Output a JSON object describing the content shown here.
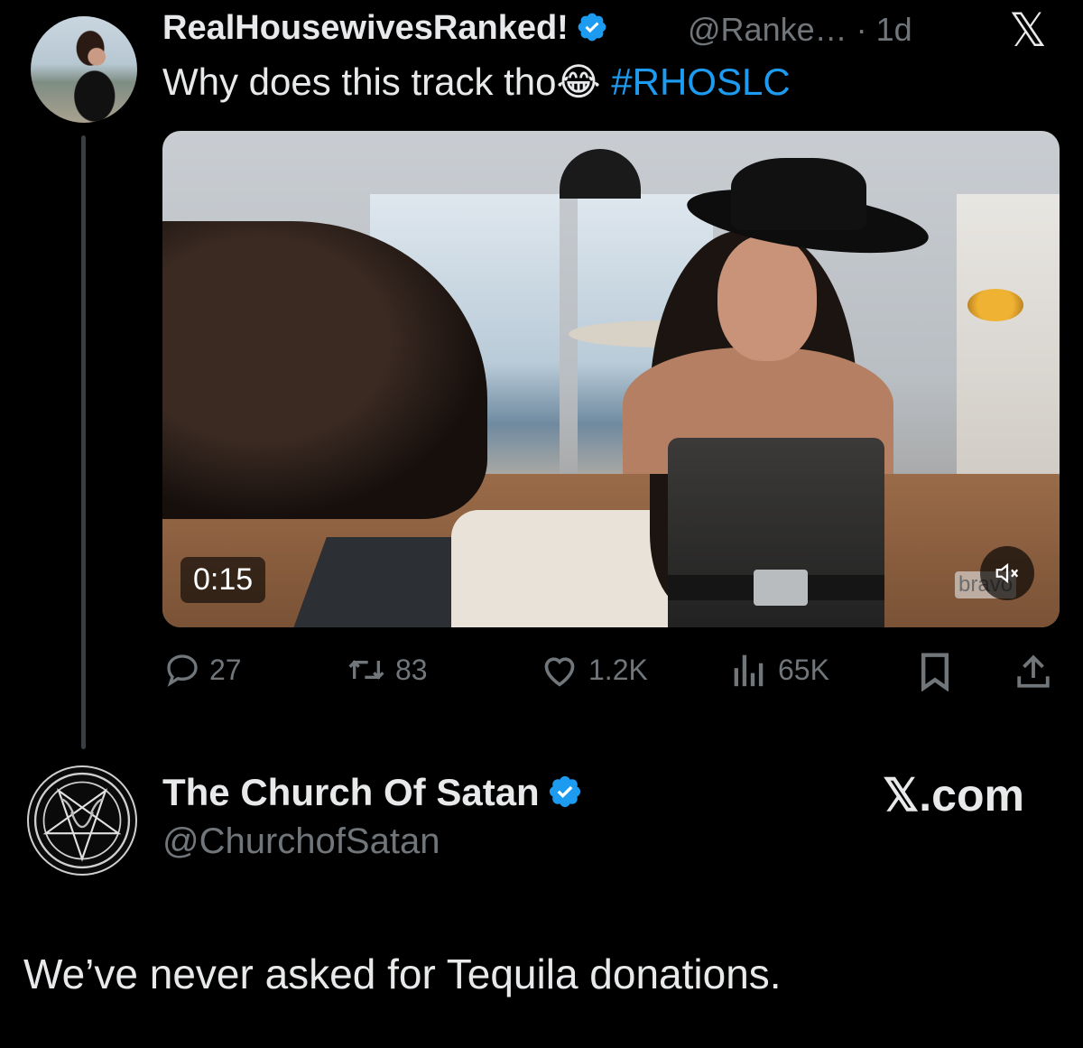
{
  "colors": {
    "background": "#000000",
    "text": "#e7e9ea",
    "muted": "#71767b",
    "link": "#1d9bf0",
    "verified": "#1d9bf0"
  },
  "tweet": {
    "author_name": "RealHousewivesRanked!",
    "author_handle": "@Ranke…",
    "time_separator": " · ",
    "time": "1d",
    "text": "Why does this track tho",
    "emoji": "😂",
    "hashtag": "#RHOSLC",
    "video": {
      "duration": "0:15",
      "watermark": "bravo",
      "muted": true
    },
    "stats": {
      "replies": "27",
      "reposts": "83",
      "likes": "1.2K",
      "views": "65K"
    }
  },
  "app_logo": "𝕏",
  "reply": {
    "author_name": "The Church Of Satan",
    "author_handle": "@ChurchofSatan",
    "site_label": "𝕏.com",
    "text": "We’ve never asked for Tequila donations."
  }
}
